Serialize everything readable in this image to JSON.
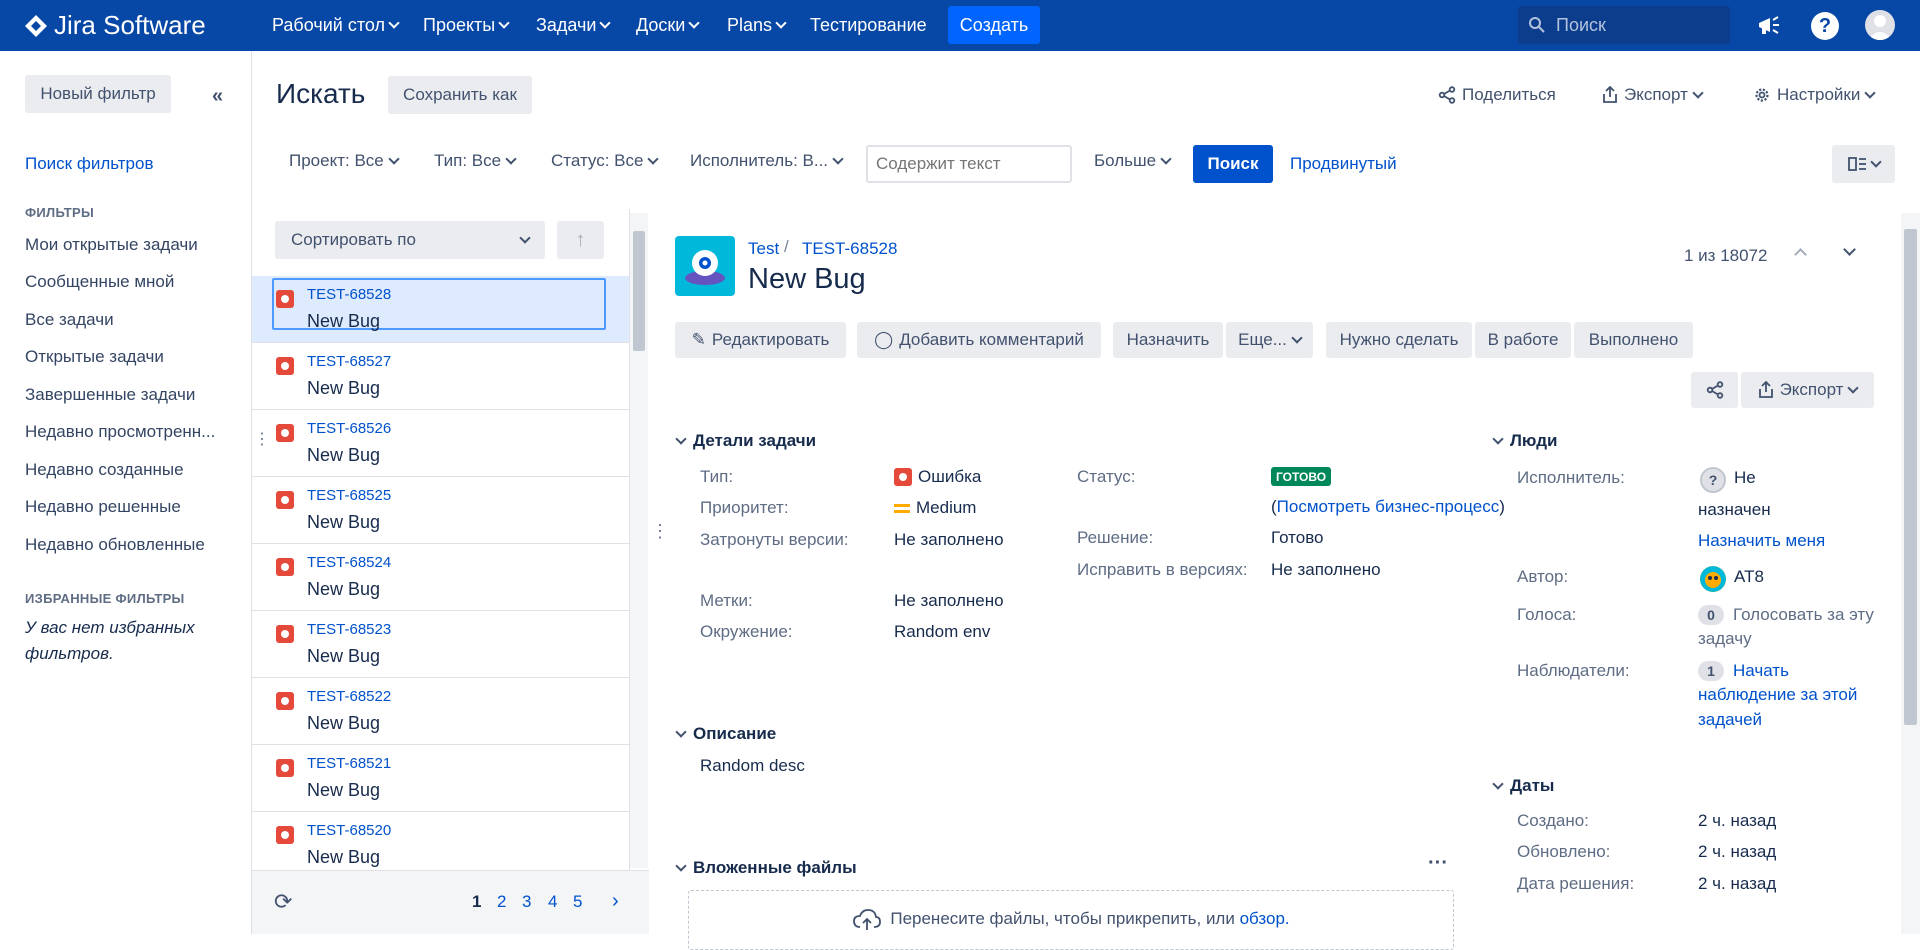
{
  "topnav": {
    "logo": "Jira Software",
    "items": [
      "Рабочий стол",
      "Проекты",
      "Задачи",
      "Доски",
      "Plans",
      "Тестирование"
    ],
    "create": "Создать",
    "search_placeholder": "Поиск"
  },
  "sidebar": {
    "new_filter": "Новый фильтр",
    "search_filters": "Поиск фильтров",
    "filters_heading": "ФИЛЬТРЫ",
    "filters": [
      "Мои открытые задачи",
      "Сообщенные мной",
      "Все задачи",
      "Открытые задачи",
      "Завершенные задачи",
      "Недавно просмотренн...",
      "Недавно созданные",
      "Недавно решенные",
      "Недавно обновленные"
    ],
    "favorites_heading": "ИЗБРАННЫЕ ФИЛЬТРЫ",
    "no_favorites": "У вас нет избранных фильтров."
  },
  "header": {
    "title": "Искать",
    "save_as": "Сохранить как",
    "share": "Поделиться",
    "export": "Экспорт",
    "settings": "Настройки"
  },
  "filters": {
    "project": "Проект: Все",
    "type": "Тип: Все",
    "status": "Статус: Все",
    "assignee": "Исполнитель: В...",
    "text_placeholder": "Содержит текст",
    "more": "Больше",
    "search": "Поиск",
    "advanced": "Продвинутый"
  },
  "list": {
    "sort": "Сортировать по",
    "issues": [
      {
        "key": "TEST-68528",
        "summary": "New Bug"
      },
      {
        "key": "TEST-68527",
        "summary": "New Bug"
      },
      {
        "key": "TEST-68526",
        "summary": "New Bug"
      },
      {
        "key": "TEST-68525",
        "summary": "New Bug"
      },
      {
        "key": "TEST-68524",
        "summary": "New Bug"
      },
      {
        "key": "TEST-68523",
        "summary": "New Bug"
      },
      {
        "key": "TEST-68522",
        "summary": "New Bug"
      },
      {
        "key": "TEST-68521",
        "summary": "New Bug"
      },
      {
        "key": "TEST-68520",
        "summary": "New Bug"
      }
    ],
    "pages": [
      "1",
      "2",
      "3",
      "4",
      "5"
    ],
    "current_page": "1"
  },
  "detail": {
    "project": "Test",
    "key": "TEST-68528",
    "title": "New Bug",
    "counter": "1 из 18072",
    "actions": {
      "edit": "Редактировать",
      "comment": "Добавить комментарий",
      "assign": "Назначить",
      "more": "Еще...",
      "todo": "Нужно сделать",
      "in_progress": "В работе",
      "done": "Выполнено",
      "export": "Экспорт"
    },
    "details_heading": "Детали задачи",
    "fields": {
      "type_label": "Тип:",
      "type_value": "Ошибка",
      "priority_label": "Приоритет:",
      "priority_value": "Medium",
      "affects_label": "Затронуты версии:",
      "affects_value": "Не заполнено",
      "labels_label": "Метки:",
      "labels_value": "Не заполнено",
      "env_label": "Окружение:",
      "env_value": "Random env",
      "status_label": "Статус:",
      "status_value": "ГОТОВО",
      "workflow_open": "(",
      "workflow_link": "Посмотреть бизнес-процесс",
      "workflow_close": ")",
      "resolution_label": "Решение:",
      "resolution_value": "Готово",
      "fix_label": "Исправить в версиях:",
      "fix_value": "Не заполнено"
    },
    "description_heading": "Описание",
    "description": "Random desc",
    "attachments_heading": "Вложенные файлы",
    "drop_text": "Перенесите файлы, чтобы прикрепить, или",
    "browse": "обзор.",
    "people": {
      "heading": "Люди",
      "assignee_label": "Исполнитель:",
      "assignee_value": "Не",
      "assignee_value2": "назначен",
      "assign_me": "Назначить меня",
      "reporter_label": "Автор:",
      "reporter_value": "AT8",
      "votes_label": "Голоса:",
      "votes_count": "0",
      "vote_text": "Голосовать за эту",
      "vote_text2": "задачу",
      "watchers_label": "Наблюдатели:",
      "watchers_count": "1",
      "watch_text": "Начать",
      "watch_text2": "наблюдение за этой",
      "watch_text3": "задачей"
    },
    "dates": {
      "heading": "Даты",
      "created_label": "Создано:",
      "created_value": "2 ч. назад",
      "updated_label": "Обновлено:",
      "updated_value": "2 ч. назад",
      "resolved_label": "Дата решения:",
      "resolved_value": "2 ч. назад"
    }
  },
  "colors": {
    "nav": "#0747a6",
    "primary": "#0065ff",
    "link": "#0052cc",
    "bug": "#e5493a",
    "done_lozenge": "#00875a"
  }
}
